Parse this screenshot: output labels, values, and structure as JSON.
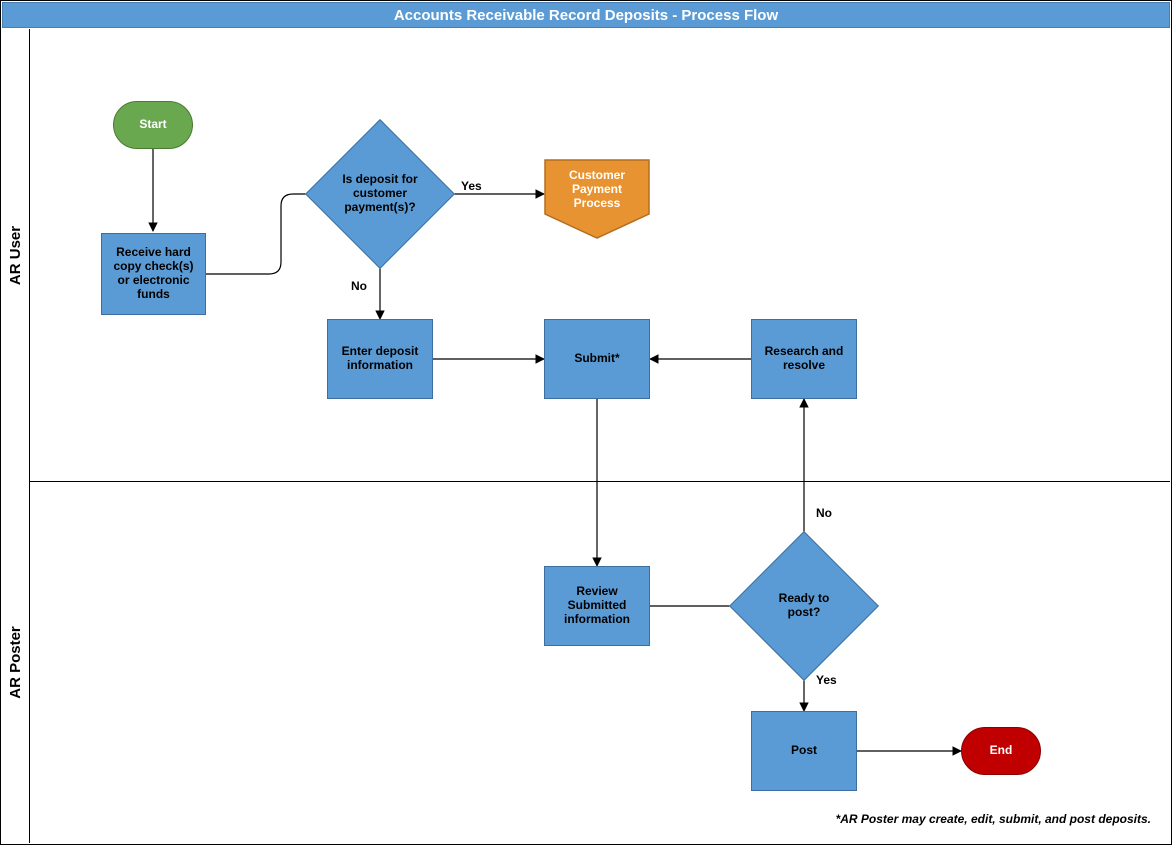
{
  "title": "Accounts Receivable Record Deposits - Process Flow",
  "lanes": {
    "ar_user": "AR User",
    "ar_poster": "AR Poster"
  },
  "nodes": {
    "start": "Start",
    "receive": "Receive hard copy check(s) or electronic funds",
    "decision_customer": "Is deposit for customer payment(s)?",
    "customer_payment_process": "Customer Payment Process",
    "enter_deposit": "Enter deposit information",
    "submit": "Submit*",
    "research_resolve": "Research and resolve",
    "review_submitted": "Review Submitted information",
    "decision_ready": "Ready to post?",
    "post": "Post",
    "end": "End"
  },
  "edges": {
    "yes1": "Yes",
    "no1": "No",
    "yes2": "Yes",
    "no2": "No"
  },
  "footnote": "*AR Poster may create, edit, submit, and post deposits."
}
